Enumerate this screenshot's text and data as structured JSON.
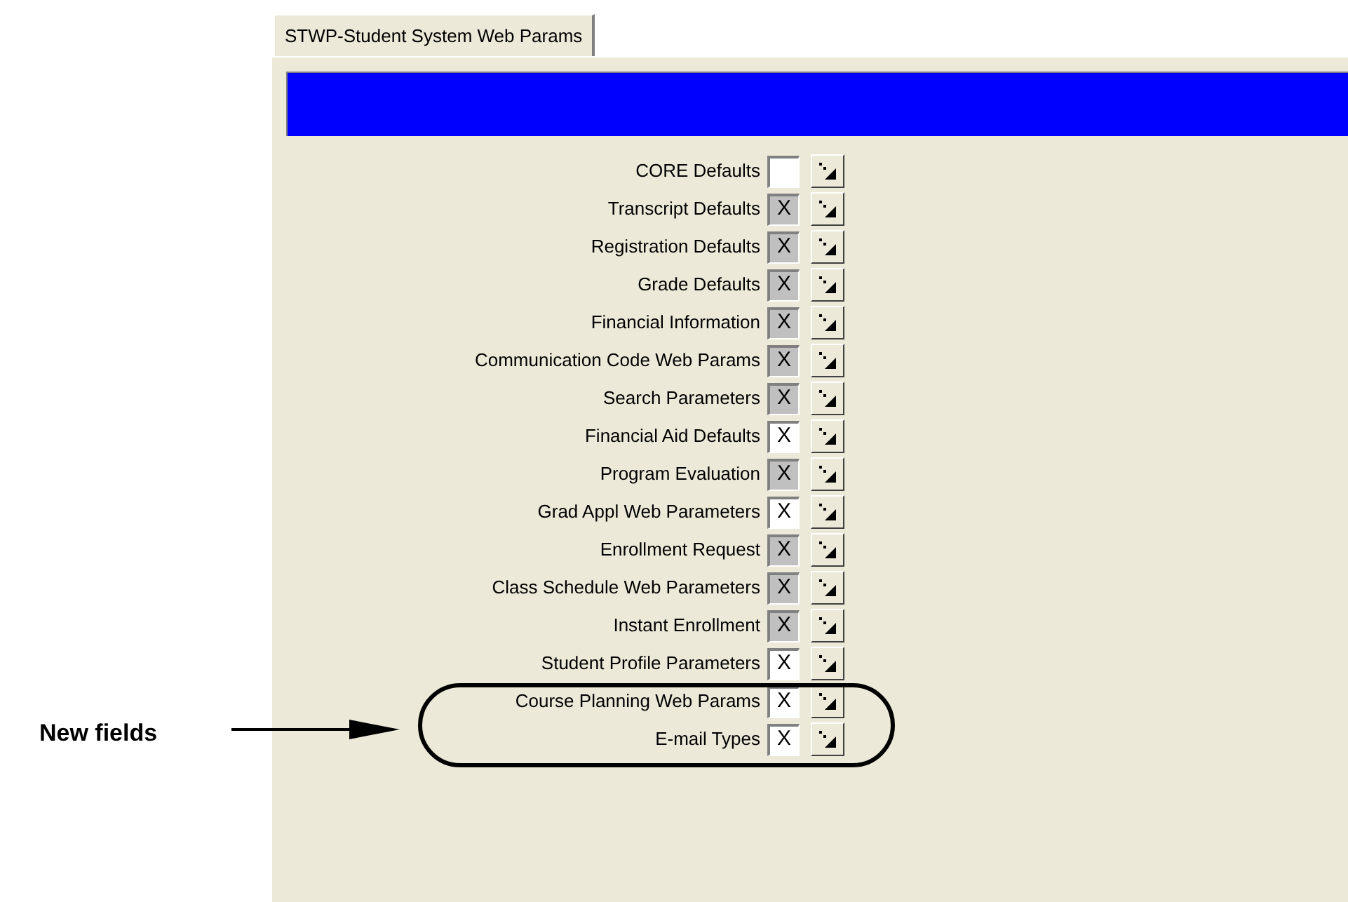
{
  "tabs": [
    {
      "label": "STWP-Student System Web Params",
      "selected": true
    }
  ],
  "rows": [
    {
      "label": "CORE Defaults",
      "value": "",
      "disabled": false
    },
    {
      "label": "Transcript Defaults",
      "value": "X",
      "disabled": true
    },
    {
      "label": "Registration Defaults",
      "value": "X",
      "disabled": true
    },
    {
      "label": "Grade Defaults",
      "value": "X",
      "disabled": true
    },
    {
      "label": "Financial Information",
      "value": "X",
      "disabled": true
    },
    {
      "label": "Communication Code Web Params",
      "value": "X",
      "disabled": true
    },
    {
      "label": "Search Parameters",
      "value": "X",
      "disabled": true
    },
    {
      "label": "Financial Aid Defaults",
      "value": "X",
      "disabled": false
    },
    {
      "label": "Program Evaluation",
      "value": "X",
      "disabled": true
    },
    {
      "label": "Grad Appl Web Parameters",
      "value": "X",
      "disabled": false
    },
    {
      "label": "Enrollment Request",
      "value": "X",
      "disabled": true
    },
    {
      "label": "Class Schedule Web Parameters",
      "value": "X",
      "disabled": true
    },
    {
      "label": "Instant Enrollment",
      "value": "X",
      "disabled": true
    },
    {
      "label": "Student Profile Parameters",
      "value": "X",
      "disabled": false
    },
    {
      "label": "Course Planning Web Params",
      "value": "X",
      "disabled": false
    },
    {
      "label": "E-mail Types",
      "value": "X",
      "disabled": false
    }
  ],
  "annotation": {
    "label": "New fields"
  }
}
